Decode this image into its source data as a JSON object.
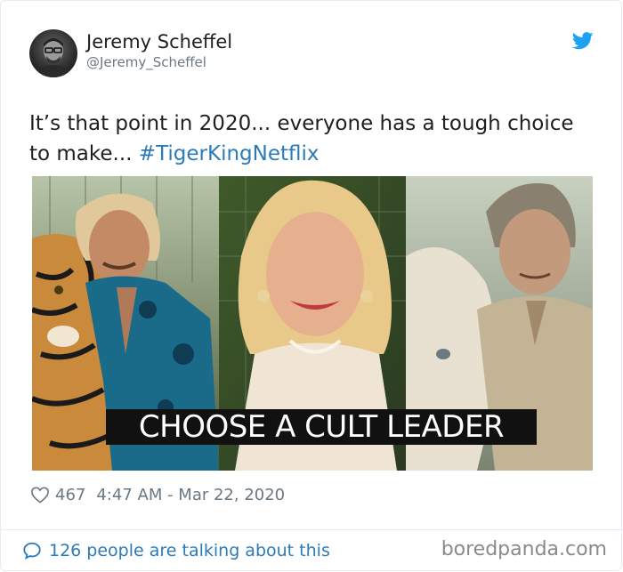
{
  "tweet": {
    "author_name": "Jeremy Scheffel",
    "author_handle": "@Jeremy_Scheffel",
    "text": "It’s that point in 2020... everyone has a tough choice to make...",
    "hashtag": "#TigerKingNetflix",
    "media_caption": "CHOOSE A CULT LEADER",
    "likes": "467",
    "timestamp": "4:47 AM - Mar 22, 2020",
    "talking_link": "126 people are talking about this"
  },
  "icons": {
    "brand": "twitter-bird-icon",
    "like": "heart-icon",
    "conversation": "speech-bubble-icon"
  },
  "colors": {
    "link": "#2b7bb9",
    "twitter_blue": "#1da1f2",
    "secondary_text": "#697882",
    "primary_text": "#1c2022"
  },
  "watermark": "boredpanda.com"
}
